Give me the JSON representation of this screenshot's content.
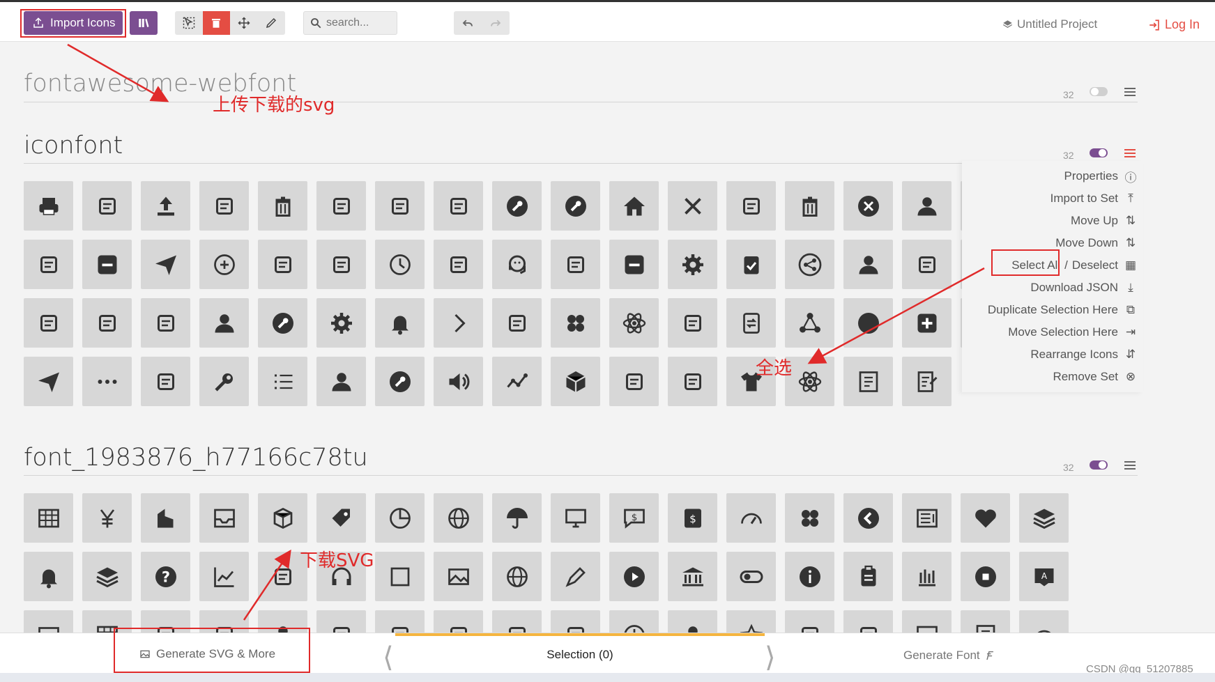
{
  "toolbar": {
    "import_label": "Import Icons",
    "search_placeholder": "search...",
    "project_name": "Untitled Project",
    "login_label": "Log In"
  },
  "sets": [
    {
      "title": "fontawesome-webfont",
      "count": "32",
      "enabled": false
    },
    {
      "title": "iconfont",
      "count": "32",
      "enabled": true
    },
    {
      "title": "font_1983876_h77166c78tu",
      "count": "32",
      "enabled": true
    }
  ],
  "context_menu": {
    "properties": "Properties",
    "import_to_set": "Import to Set",
    "move_up": "Move Up",
    "move_down": "Move Down",
    "select_all": "Select All",
    "separator": "/",
    "deselect": "Deselect",
    "download_json": "Download JSON",
    "duplicate_selection": "Duplicate Selection Here",
    "move_selection": "Move Selection Here",
    "rearrange_icons": "Rearrange Icons",
    "remove_set": "Remove Set"
  },
  "footer": {
    "generate_svg": "Generate SVG & More",
    "selection": "Selection (0)",
    "generate_font": "Generate Font"
  },
  "annotations": {
    "upload_svg": "上传下载的svg",
    "select_all": "全选",
    "download_svg": "下载SVG"
  },
  "watermark": "CSDN @qq_51207885",
  "colors": {
    "accent": "#7b4e91",
    "danger": "#e44d43",
    "annotation": "#e02a2a",
    "highlight": "#f5b53f"
  },
  "icon_glyphs": [
    "printer",
    "image-edit",
    "upload",
    "tools",
    "trash",
    "layout",
    "palette",
    "close-box",
    "wrench-circle",
    "wrench-circle",
    "home",
    "close",
    "text-box",
    "trash",
    "close-circle",
    "user",
    "close-light",
    "hand",
    "minus-box",
    "send",
    "plus-circle",
    "user-edit",
    "server",
    "clock",
    "signature",
    "headset",
    "list-up",
    "minus-box",
    "gear",
    "clipboard-check",
    "share-circle",
    "user",
    "doc-search",
    "user-light",
    "trash-circle",
    "logout",
    "compress",
    "user",
    "wrench-circle",
    "gear",
    "bell",
    "chevron-right",
    "edit-doc",
    "grid4",
    "atom",
    "file-list",
    "exchange",
    "nodes",
    "circle",
    "plus-box",
    "sitemap",
    "send",
    "more",
    "user-star",
    "wrench",
    "list",
    "user",
    "wrench-circle",
    "volume",
    "chart-line",
    "box",
    "pin",
    "car",
    "shirt",
    "atom",
    "doc",
    "doc-edit",
    "table",
    "yen",
    "building",
    "inbox",
    "cube",
    "tag",
    "pie",
    "globe",
    "umbrella",
    "monitor",
    "chat-dollar",
    "wallet",
    "gauge",
    "grid4",
    "back-circle",
    "doc-lines",
    "heart",
    "layers",
    "bell",
    "layers",
    "question",
    "chart",
    "doc-list",
    "headphones",
    "square",
    "image",
    "globe",
    "pencil",
    "play",
    "bank",
    "toggle",
    "info",
    "clipboard",
    "bars",
    "stop",
    "image-tag",
    "image",
    "table",
    "calendar",
    "usb",
    "user",
    "bag",
    "cloud",
    "grid",
    "hand",
    "alert",
    "clock",
    "user",
    "star",
    "bug",
    "speaker",
    "monitor",
    "doc",
    "gauge"
  ]
}
